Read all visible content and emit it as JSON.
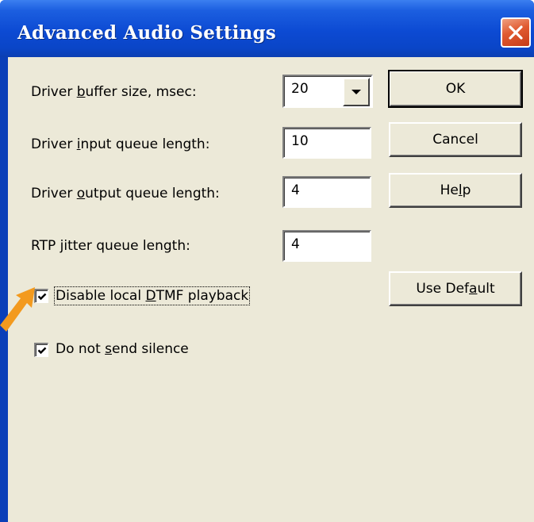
{
  "window": {
    "title": "Advanced Audio Settings"
  },
  "fields": {
    "buffer_size": {
      "label_pre": "Driver ",
      "label_u": "b",
      "label_post": "uffer size, msec:",
      "value": "20"
    },
    "input_queue": {
      "label_pre": "Driver ",
      "label_u": "i",
      "label_post": "nput queue length:",
      "value": "10"
    },
    "output_queue": {
      "label_pre": "Driver ",
      "label_u": "o",
      "label_post": "utput queue length:",
      "value": "4"
    },
    "jitter_queue": {
      "label_pre": "RTP ",
      "label_u": "j",
      "label_post": "itter queue length:",
      "value": "4"
    }
  },
  "checkboxes": {
    "disable_dtmf": {
      "label_pre": "Disable local ",
      "label_u": "D",
      "label_post": "TMF playback",
      "checked": true
    },
    "no_silence": {
      "label_pre": "Do not ",
      "label_u": "s",
      "label_post": "end silence",
      "checked": true
    }
  },
  "buttons": {
    "ok": "OK",
    "cancel": "Cancel",
    "help_pre": "He",
    "help_u": "l",
    "help_post": "p",
    "use_default_pre": "Use Def",
    "use_default_u": "a",
    "use_default_post": "ult"
  },
  "colors": {
    "titlebar": "#0a45c7",
    "dialog_bg": "#ece9d8",
    "close_button": "#e05a30",
    "annotation_arrow": "#f39a1e"
  },
  "icons": {
    "close": "close-x-icon",
    "dropdown": "dropdown-arrow-icon",
    "check": "checkmark-icon",
    "annotation": "pointer-arrow-icon"
  }
}
